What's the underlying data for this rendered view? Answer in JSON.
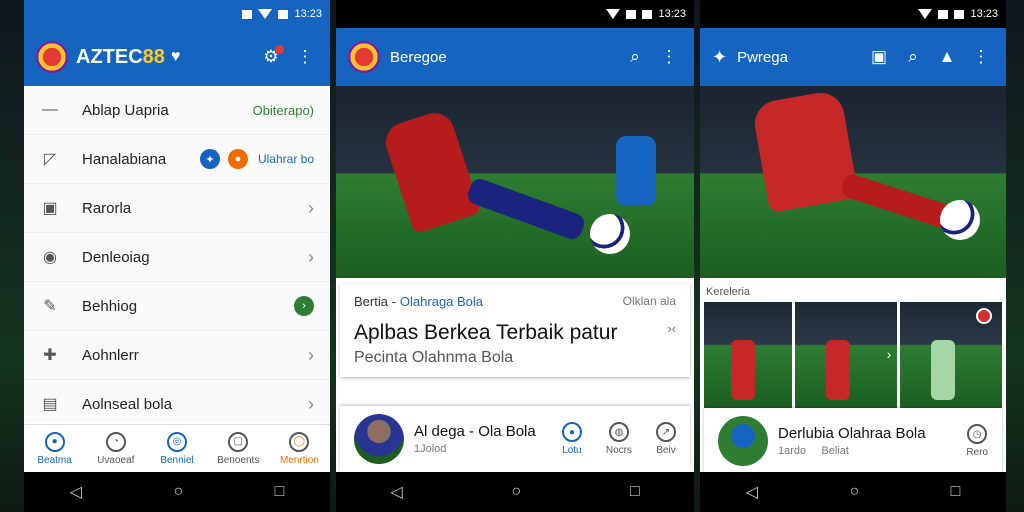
{
  "screens": {
    "left": {
      "status_time": "13:23",
      "brand_prefix": "AZTEC",
      "brand_number": "88",
      "drawer": [
        {
          "label": "Ablap Uapria",
          "right": "Obiterapo)"
        },
        {
          "label": "Hanalabiana",
          "right": "Ulahrar bo"
        },
        {
          "label": "Rarorla"
        },
        {
          "label": "Denleoiag"
        },
        {
          "label": "Behhiog"
        },
        {
          "label": "Aohnlerr"
        },
        {
          "label": "Aolnseal bola"
        }
      ],
      "bottom_nav": [
        "Beatma",
        "Uvaoeaf",
        "Benniel",
        "Benoents",
        "Menrtion"
      ]
    },
    "center": {
      "status_time": "13:23",
      "title": "Beregoe",
      "meta_label": "Bertia",
      "meta_category": "Olahraga Bola",
      "meta_source": "Olklan ala",
      "headline": "Aplbas Berkea Terbaik patur",
      "subhead": "Pecinta Olahnma Bola",
      "card2_title": "Al dega - Ola Bola",
      "card2_sub": "1Jolod",
      "card2_nav": [
        "Lotu",
        "Nocrs",
        "Beiv"
      ]
    },
    "right": {
      "status_time": "13:23",
      "title": "Pwrega",
      "section_label": "Kereleria",
      "card2_title": "Derlubia Olahraa Bola",
      "card2_sub": "1ardo",
      "card2_sub2": "Beliat",
      "card2_nav": "Rero"
    }
  },
  "colors": {
    "primary": "#1565c0",
    "accent": "#ef6c00",
    "positive": "#2e7d32"
  }
}
